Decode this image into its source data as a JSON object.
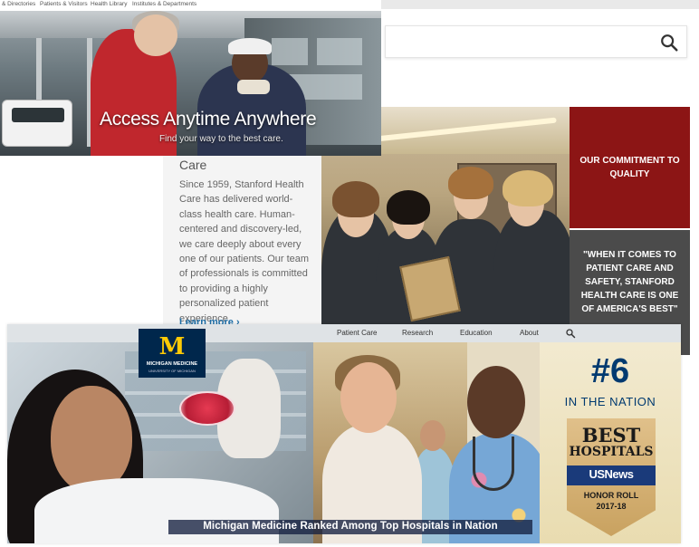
{
  "stanford": {
    "section_fragment": "Care",
    "description": "Since 1959, Stanford Health Care has delivered world-class health care. Human-centered and discovery-led, we care deeply about every one of our patients. Our team of professionals is committed to providing a highly personalized patient experience.",
    "learn_more": "Learn more ›",
    "commitment": "OUR COMMITMENT TO QUALITY",
    "quote": "\"WHEN IT COMES TO PATIENT CARE AND SAFETY, STANFORD HEALTH CARE IS ONE OF AMERICA'S BEST\"",
    "search_icon": "search-icon",
    "brand_red": "#8c1515"
  },
  "access": {
    "nav": [
      "& Directories",
      "Patients & Visitors",
      "Health Library",
      "Institutes & Departments"
    ],
    "title": "Access Anytime Anywhere",
    "subtitle": "Find your way to the best care."
  },
  "michigan": {
    "nav": [
      "Patient Care",
      "Research",
      "Education",
      "About"
    ],
    "nav_search_icon": "search-icon",
    "logo_letter": "M",
    "logo_name": "MICHIGAN MEDICINE",
    "logo_sub": "UNIVERSITY OF MICHIGAN",
    "rank": "#6",
    "rank_sub": "IN THE NATION",
    "badge_best": "BEST",
    "badge_hospitals": "HOSPITALS",
    "badge_brand": "USNews",
    "badge_honor": "HONOR ROLL",
    "badge_year": "2017-18",
    "caption": "Michigan Medicine Ranked Among Top Hospitals in Nation",
    "brand_blue": "#00274c",
    "brand_maize": "#ffcb05"
  }
}
